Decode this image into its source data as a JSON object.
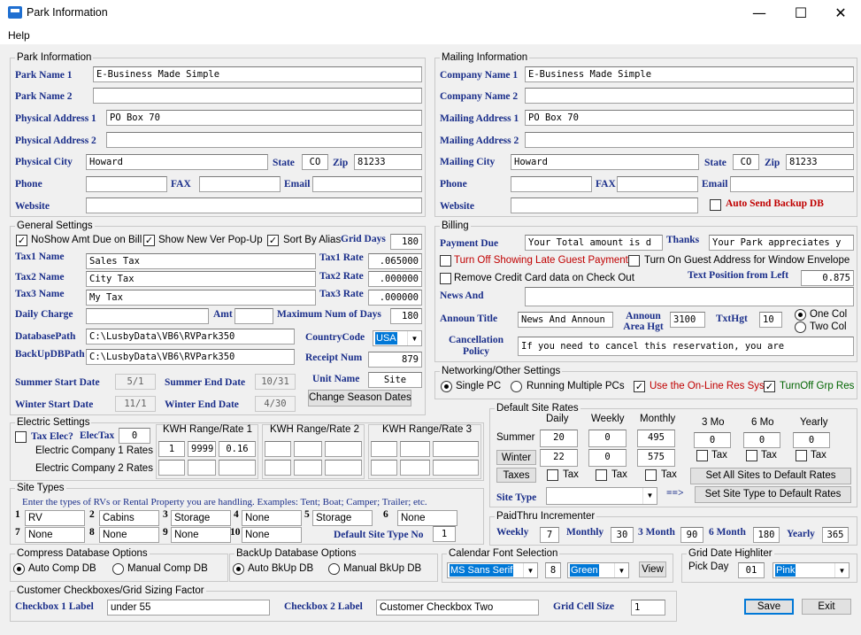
{
  "window": {
    "title": "Park Information",
    "minimize": "—",
    "maximize": "☐",
    "close": "✕"
  },
  "menu": {
    "help": "Help"
  },
  "park": {
    "legend": "Park Information",
    "name1_label": "Park Name 1",
    "name1": "E-Business Made Simple",
    "name2_label": "Park Name 2",
    "name2": "",
    "addr1_label": "Physical Address 1",
    "addr1": "PO Box 70",
    "addr2_label": "Physical Address 2",
    "addr2": "",
    "city_label": "Physical City",
    "city": "Howard",
    "state_label": "State",
    "state": "CO",
    "zip_label": "Zip",
    "zip": "81233",
    "phone_label": "Phone",
    "phone": "",
    "fax_label": "FAX",
    "fax": "",
    "email_label": "Email",
    "email": "",
    "website_label": "Website",
    "website": ""
  },
  "mailing": {
    "legend": "Mailing Information",
    "company1_label": "Company Name 1",
    "company1": "E-Business Made Simple",
    "company2_label": "Company Name 2",
    "company2": "",
    "addr1_label": "Mailing Address 1",
    "addr1": "PO Box 70",
    "addr2_label": "Mailing Address 2",
    "addr2": "",
    "city_label": "Mailing City",
    "city": "Howard",
    "state_label": "State",
    "state": "CO",
    "zip_label": "Zip",
    "zip": "81233",
    "phone_label": "Phone",
    "phone": "",
    "fax_label": "FAX",
    "fax": "",
    "email_label": "Email",
    "email": "",
    "website_label": "Website",
    "website": "",
    "auto_send_label": "Auto Send Backup DB"
  },
  "general": {
    "legend": "General Settings",
    "noshow_label": "NoShow Amt Due on Bill",
    "noshow_checked": true,
    "newver_label": "Show New Ver Pop-Up",
    "newver_checked": true,
    "sortalias_label": "Sort By Alias",
    "sortalias_checked": true,
    "griddays_label": "Grid Days",
    "griddays": "180",
    "tax1_name_label": "Tax1 Name",
    "tax1_name": "Sales Tax",
    "tax1_rate_label": "Tax1 Rate",
    "tax1_rate": ".065000",
    "tax2_name_label": "Tax2 Name",
    "tax2_name": "City Tax",
    "tax2_rate_label": "Tax2 Rate",
    "tax2_rate": ".000000",
    "tax3_name_label": "Tax3 Name",
    "tax3_name": "My Tax",
    "tax3_rate_label": "Tax3 Rate",
    "tax3_rate": ".000000",
    "daily_charge_label": "Daily Charge",
    "daily_charge": "",
    "amt_label": "Amt",
    "amt": "",
    "maxdays_label": "Maximum Num of Days",
    "maxdays": "180",
    "dbpath_label": "DatabasePath",
    "dbpath": "C:\\LusbyData\\VB6\\RVPark350",
    "country_label": "CountryCode",
    "country": "USA",
    "backup_label": "BackUpDBPath",
    "backup": "C:\\LusbyData\\VB6\\RVPark350",
    "receipt_label": "Receipt Num",
    "receipt": "879",
    "unitname_label": "Unit Name",
    "unitname": "Site",
    "summer_start_label": "Summer Start Date",
    "summer_start": "5/1",
    "summer_end_label": "Summer End Date",
    "summer_end": "10/31",
    "winter_start_label": "Winter Start Date",
    "winter_start": "11/1",
    "winter_end_label": "Winter End Date",
    "winter_end": "4/30",
    "change_season_btn": "Change Season Dates"
  },
  "billing": {
    "legend": "Billing",
    "payment_due_label": "Payment Due",
    "payment_due": "Your Total amount is d",
    "thanks_label": "Thanks",
    "thanks": "Your Park appreciates y",
    "late_label": "Turn Off Showing Late Guest Payments",
    "guestaddr_label": "Turn On Guest Address for Window Envelope",
    "removecc_label": "Remove Credit Card data on Check Out",
    "textpos_label": "Text Position from Left",
    "textpos": "0.875",
    "newsand_label": "News And",
    "newsand": "",
    "annoutitle_label": "Announ Title",
    "annoutitle": "News And Announ",
    "annouarea_label": "Announ Area Hgt",
    "annouarea": "3100",
    "txthgt_label": "TxtHgt",
    "txthgt": "10",
    "onecol_label": "One Col",
    "twocol_label": "Two Col",
    "cancel_label": "Cancellation Policy",
    "cancel": "If you need to cancel this reservation, you are"
  },
  "network": {
    "legend": "Networking/Other Settings",
    "single_label": "Single PC",
    "multi_label": "Running Multiple PCs",
    "online_label": "Use the On-Line Res Sys",
    "grp_label": "TurnOff Grp Res"
  },
  "electric": {
    "legend": "Electric Settings",
    "taxelec_label": "Tax Elec?",
    "electax_label": "ElecTax",
    "electax": "0",
    "co1_label": "Electric Company 1 Rates",
    "co2_label": "Electric Company 2 Rates",
    "kwh1_label": "KWH Range/Rate 1",
    "kwh2_label": "KWH Range/Rate 2",
    "kwh3_label": "KWH Range/Rate 3",
    "kwh1_co1": [
      "1",
      "9999",
      "0.16"
    ]
  },
  "rates": {
    "legend": "Default Site Rates",
    "daily_label": "Daily",
    "weekly_label": "Weekly",
    "monthly_label": "Monthly",
    "mo3_label": "3 Mo",
    "mo6_label": "6 Mo",
    "yearly_label": "Yearly",
    "summer_label": "Summer",
    "winter_label": "Winter",
    "taxes_btn": "Taxes",
    "tax_label": "Tax",
    "summer_daily": "20",
    "summer_weekly": "0",
    "summer_monthly": "495",
    "winter_daily": "22",
    "winter_weekly": "0",
    "winter_monthly": "575",
    "mo3": "0",
    "mo6": "0",
    "yearly": "0",
    "set_all_btn": "Set All Sites to Default Rates",
    "site_type_label": "Site Type",
    "arrow": "==>",
    "set_type_btn": "Set Site Type to Default Rates"
  },
  "sitetypes": {
    "legend": "Site Types",
    "intro": "Enter the types of RVs or Rental Property you are handling. Examples: Tent; Boat; Camper; Trailer; etc.",
    "n1": "1",
    "n2": "2",
    "n3": "3",
    "n4": "4",
    "n5": "5",
    "n6": "6",
    "n7": "7",
    "n8": "8",
    "n9": "9",
    "n10": "10",
    "t1": "RV",
    "t2": "Cabins",
    "t3": "Storage",
    "t4": "None",
    "t5": "Storage",
    "t6": "None",
    "t7": "None",
    "t8": "None",
    "t9": "None",
    "t10": "None",
    "default_label": "Default Site Type No",
    "default": "1"
  },
  "paidthru": {
    "legend": "PaidThru Incrementer",
    "weekly_label": "Weekly",
    "weekly": "7",
    "monthly_label": "Monthly",
    "monthly": "30",
    "m3_label": "3 Month",
    "m3": "90",
    "m6_label": "6 Month",
    "m6": "180",
    "yearly_label": "Yearly",
    "yearly": "365"
  },
  "compress": {
    "legend": "Compress Database Options",
    "auto": "Auto Comp DB",
    "manual": "Manual Comp DB"
  },
  "bkup": {
    "legend": "BackUp Database Options",
    "auto": "Auto BkUp DB",
    "manual": "Manual BkUp DB"
  },
  "calfont": {
    "legend": "Calendar Font Selection",
    "font": "MS Sans Serif",
    "size": "8",
    "color": "Green",
    "view_btn": "View"
  },
  "gridhl": {
    "legend": "Grid Date Highliter",
    "pickday_label": "Pick Day",
    "pickday": "01",
    "color": "Pink"
  },
  "custcb": {
    "legend": "Customer Checkboxes/Grid Sizing Factor",
    "cb1_label": "Checkbox 1 Label",
    "cb1": "under 55",
    "cb2_label": "Checkbox 2 Label",
    "cb2": "Customer Checkbox Two",
    "gridcell_label": "Grid Cell Size",
    "gridcell": "1"
  },
  "buttons": {
    "save": "Save",
    "exit": "Exit"
  }
}
